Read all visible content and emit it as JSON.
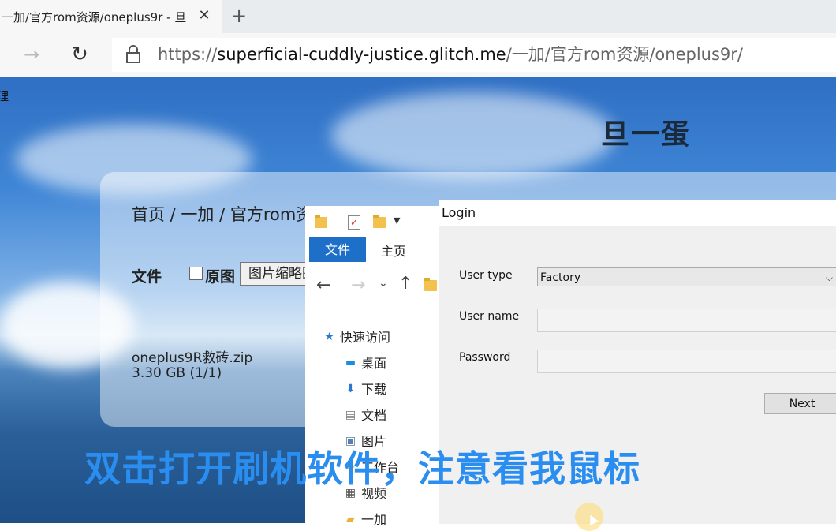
{
  "browser": {
    "tab_title": "一加/官方rom资源/oneplus9r - 旦",
    "tab_close": "✕",
    "new_tab": "+",
    "url_scheme": "https://",
    "url_host": "superficial-cuddly-justice.glitch.me",
    "url_path": "/一加/官方rom资源/oneplus9r/"
  },
  "page": {
    "corner_text": "理",
    "site_title": "旦一蛋",
    "breadcrumb": "首页 / 一加 / 官方rom资源",
    "file_label": "文件",
    "original_label": "原图",
    "thumb_select": "图片缩略图",
    "file_name": "oneplus9R救砖.zip",
    "file_size": "3.30 GB (1/1)"
  },
  "explorer": {
    "tab_file": "文件",
    "tab_home": "主页",
    "nav_items": [
      {
        "label": "快速访问",
        "icon": "star-icon"
      },
      {
        "label": "桌面",
        "icon": "desktop-icon"
      },
      {
        "label": "下载",
        "icon": "download-icon"
      },
      {
        "label": "文档",
        "icon": "document-icon"
      },
      {
        "label": "图片",
        "icon": "picture-icon"
      },
      {
        "label": "工作台",
        "icon": "folder-icon"
      },
      {
        "label": "视频",
        "icon": "video-icon"
      },
      {
        "label": "一加",
        "icon": "folder-icon"
      }
    ]
  },
  "login": {
    "title": "Login",
    "user_type_label": "User type",
    "user_type_value": "Factory",
    "user_name_label": "User name",
    "user_name_value": "",
    "password_label": "Password",
    "password_value": "",
    "next_label": "Next"
  },
  "overlay": {
    "subtitle": "双击打开刷机软件，注意看我鼠标"
  },
  "colors": {
    "accent_blue": "#1e6fc8",
    "subtitle_blue": "#2a8ef0"
  }
}
